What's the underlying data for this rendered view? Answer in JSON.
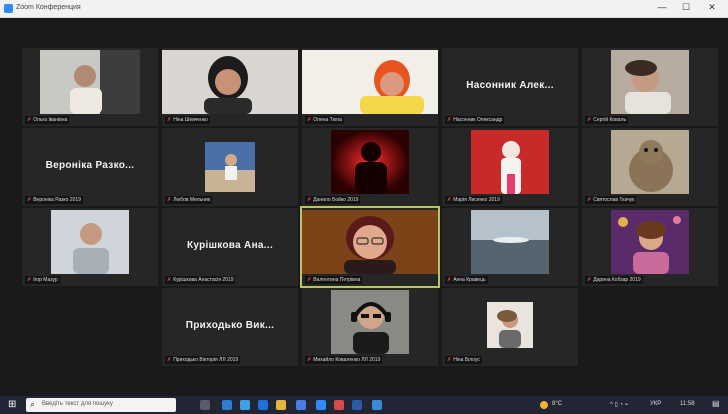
{
  "window": {
    "title": "Zoom Конференция",
    "minimize": "—",
    "maximize": "☐",
    "close": "✕"
  },
  "tiles": [
    {
      "key": "r1c1",
      "type": "video",
      "label": "Ольга Іванівна",
      "bg": "#c9c9c4"
    },
    {
      "key": "r1c2",
      "type": "video",
      "label": "Ніна Шевченко",
      "bg": "#d9d6d2"
    },
    {
      "key": "r1c3",
      "type": "video",
      "label": "Олена Тюпа",
      "bg": "#f5d84a"
    },
    {
      "key": "r1c4",
      "type": "name",
      "big": "Насонник Алек...",
      "label": "Насонник Олександр"
    },
    {
      "key": "r1c5",
      "type": "video",
      "label": "Сергій Коваль",
      "bg": "#7b6a5d"
    },
    {
      "key": "r2c1",
      "type": "name",
      "big": "Вероніка Разко...",
      "label": "Вероніка Разко 2019"
    },
    {
      "key": "r2c2",
      "type": "video",
      "label": "Любов Мельник",
      "bg": "#4a6fa8"
    },
    {
      "key": "r2c3",
      "type": "video",
      "label": "Данило Бойко 2019",
      "bg": "#5a0606"
    },
    {
      "key": "r2c4",
      "type": "video",
      "label": "Марія Лисенко 2019",
      "bg": "#c82a2a"
    },
    {
      "key": "r2c5",
      "type": "video",
      "label": "Святослав Ткачук",
      "bg": "#8a7a64"
    },
    {
      "key": "r3c1",
      "type": "video",
      "label": "Ігор Мазур",
      "bg": "#cfd5da"
    },
    {
      "key": "r3c2",
      "type": "name",
      "big": "Курішкова Ана...",
      "label": "Курішкова Анастасія 2019"
    },
    {
      "key": "r3c3",
      "type": "video",
      "label": "Валентина Петрівна",
      "bg": "#7a4418",
      "active": true
    },
    {
      "key": "r3c4",
      "type": "video",
      "label": "Анна Кравець",
      "bg": "#7e8c98"
    },
    {
      "key": "r3c5",
      "type": "video",
      "label": "Дарина Кобзар 2019",
      "bg": "#5a2a6a"
    },
    {
      "key": "r4c2",
      "type": "name",
      "big": "Приходько Вик...",
      "label": "Приходько Вікторія ЛЛ 2019"
    },
    {
      "key": "r4c3",
      "type": "video",
      "label": "Михайло Коваленко ЛЛ 2019",
      "bg": "#8a8a84"
    },
    {
      "key": "r4c4",
      "type": "video",
      "label": "Ніна Білоус",
      "bg": "#a59a8a"
    }
  ],
  "taskbar": {
    "search_placeholder": "Введіть текст для пошуку",
    "weather": "8°C",
    "lang": "УКР",
    "clock": "11:58"
  }
}
